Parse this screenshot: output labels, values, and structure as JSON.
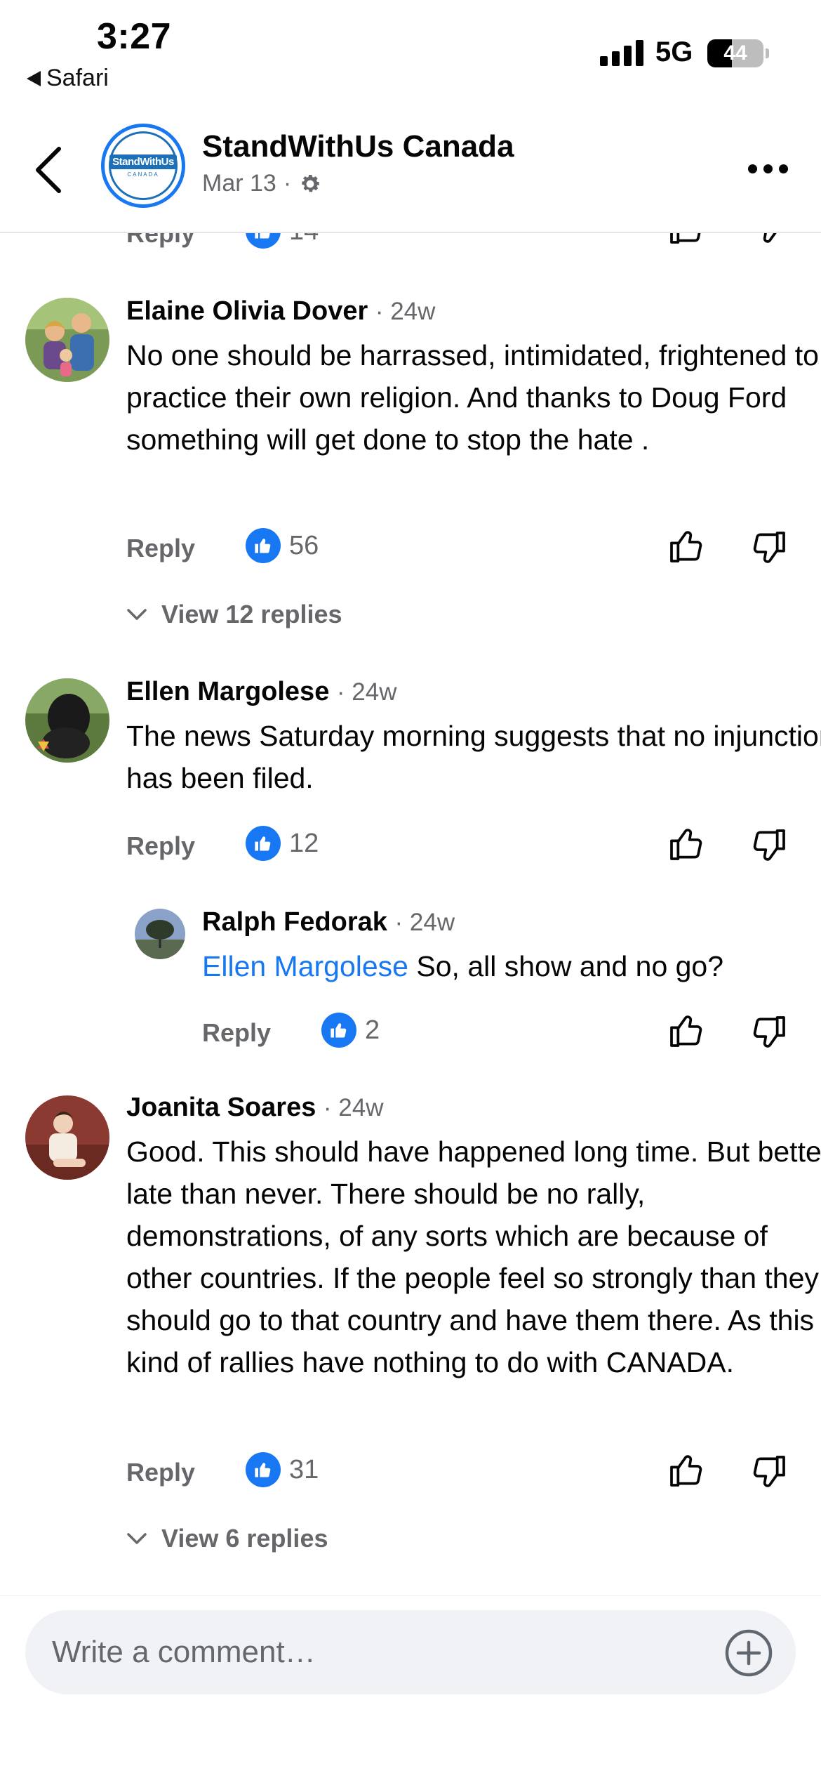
{
  "status_bar": {
    "time": "3:27",
    "back_app": "Safari",
    "network": "5G",
    "battery": "44",
    "battery_level": 0.44
  },
  "header": {
    "page_name": "StandWithUs Canada",
    "date": "Mar 13",
    "separator": "·",
    "logo_text": "StandWithUs",
    "logo_sub": "CANADA",
    "privacy_icon": "gear-icon"
  },
  "labels": {
    "reply": "Reply"
  },
  "partial_row": {
    "reply": "Reply",
    "likes": "14"
  },
  "comments": [
    {
      "author": "Elaine Olivia Dover",
      "time": "· 24w",
      "text": "No one should be harrassed, intimidated, frightened to practice their own religion. And thanks to Doug Ford something will get done to stop the hate .",
      "likes": "56",
      "view_replies": "View 12 replies"
    },
    {
      "author": "Ellen Margolese",
      "time": "· 24w",
      "text": "The news Saturday morning suggests that no injunction has been filed.",
      "likes": "12",
      "reply": {
        "author": "Ralph Fedorak",
        "time": "· 24w",
        "mention": "Ellen Margolese",
        "text": " So, all show and no go?",
        "likes": "2"
      }
    },
    {
      "author": "Joanita Soares",
      "time": "· 24w",
      "text": "Good. This should have happened long time. But better late than never. There should be no rally, demonstrations, of any sorts which are because of other countries. If the people feel so strongly than they should go to that country and have them there. As this kind of rallies have nothing to do with CANADA.",
      "likes": "31",
      "view_replies": "View 6 replies"
    }
  ],
  "composer": {
    "placeholder": "Write a comment…"
  },
  "colors": {
    "accent": "#1877f2",
    "secondary_text": "#65676b",
    "composer_bg": "#f0f2f5"
  }
}
